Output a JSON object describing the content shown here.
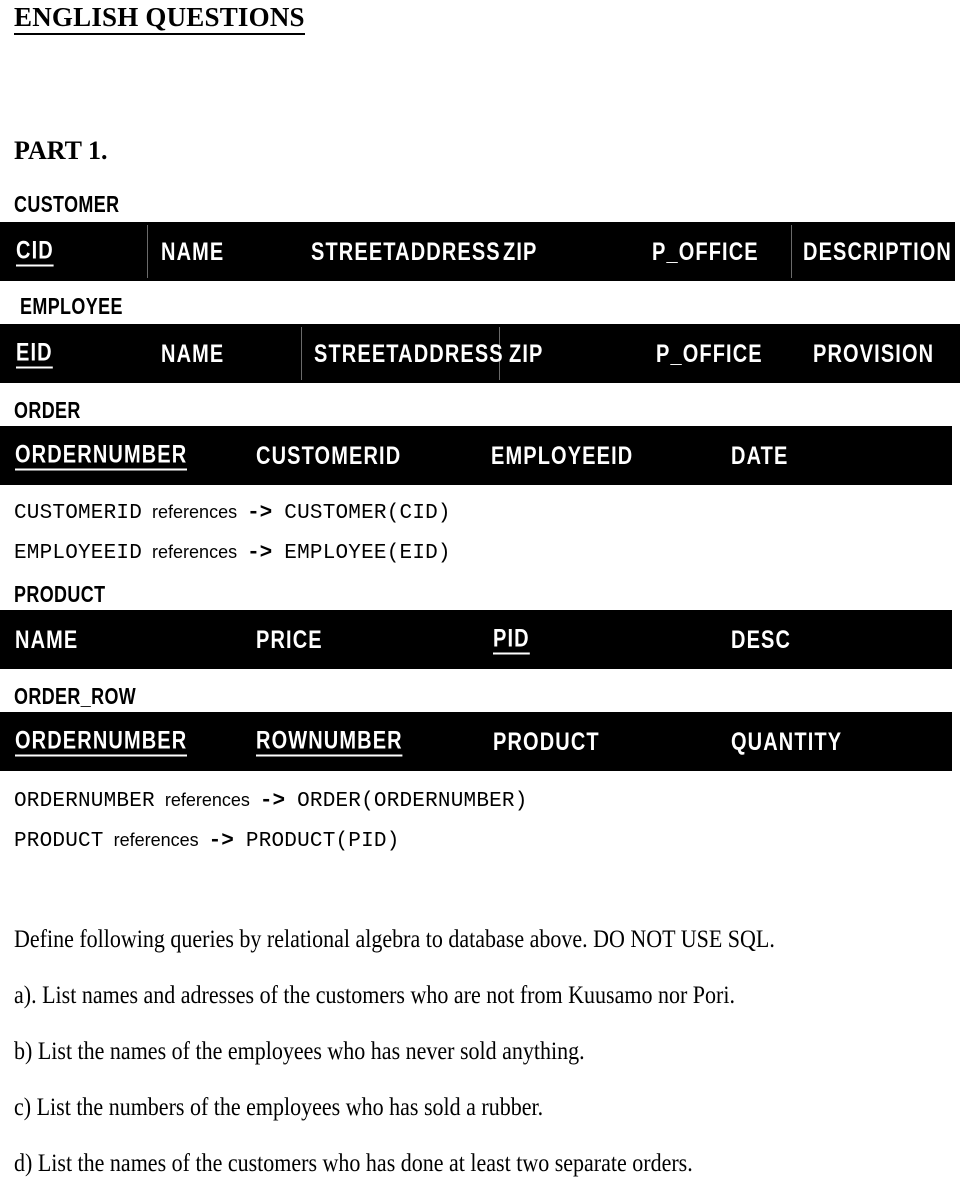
{
  "document": {
    "title": "ENGLISH QUESTIONS",
    "part_heading": "PART 1."
  },
  "tables": [
    {
      "name": "CUSTOMER",
      "columns": [
        "CID",
        "NAME",
        "STREETADDRESS",
        "ZIP",
        "P_OFFICE",
        "DESCRIPTION"
      ],
      "primary_keys": [
        "CID"
      ]
    },
    {
      "name": "EMPLOYEE",
      "columns": [
        "EID",
        "NAME",
        "STREETADDRESS",
        "ZIP",
        "P_OFFICE",
        "PROVISION"
      ],
      "primary_keys": [
        "EID"
      ]
    },
    {
      "name": "ORDER",
      "columns": [
        "ORDERNUMBER",
        "CUSTOMERID",
        "EMPLOYEEID",
        "DATE"
      ],
      "primary_keys": [
        "ORDERNUMBER"
      ]
    },
    {
      "name": "PRODUCT",
      "columns": [
        "NAME",
        "PRICE",
        "PID",
        "DESC"
      ],
      "primary_keys": [
        "PID"
      ]
    },
    {
      "name": "ORDER_ROW",
      "columns": [
        "ORDERNUMBER",
        "ROWNUMBER",
        "PRODUCT",
        "QUANTITY"
      ],
      "primary_keys": [
        "ORDERNUMBER",
        "ROWNUMBER"
      ]
    }
  ],
  "references": {
    "keyword": "references",
    "arrow": "->",
    "order_table": [
      {
        "column": "CUSTOMERID",
        "target": "CUSTOMER(CID)"
      },
      {
        "column": "EMPLOYEEID",
        "target": "EMPLOYEE(EID)"
      }
    ],
    "order_row_table": [
      {
        "column": "ORDERNUMBER",
        "target": "ORDER(ORDERNUMBER)"
      },
      {
        "column": "PRODUCT",
        "target": "PRODUCT(PID)"
      }
    ]
  },
  "instructions": {
    "lead_in": "Define following queries by relational algebra to database above. DO NOT USE SQL.",
    "questions": [
      "a).  List names and adresses of the customers who are not from Kuusamo nor Pori.",
      "b)  List the names of the employees who has never sold anything.",
      "c) List the numbers of the employees who has sold a rubber.",
      "d) List the names of the customers who has done at least two separate orders."
    ]
  }
}
